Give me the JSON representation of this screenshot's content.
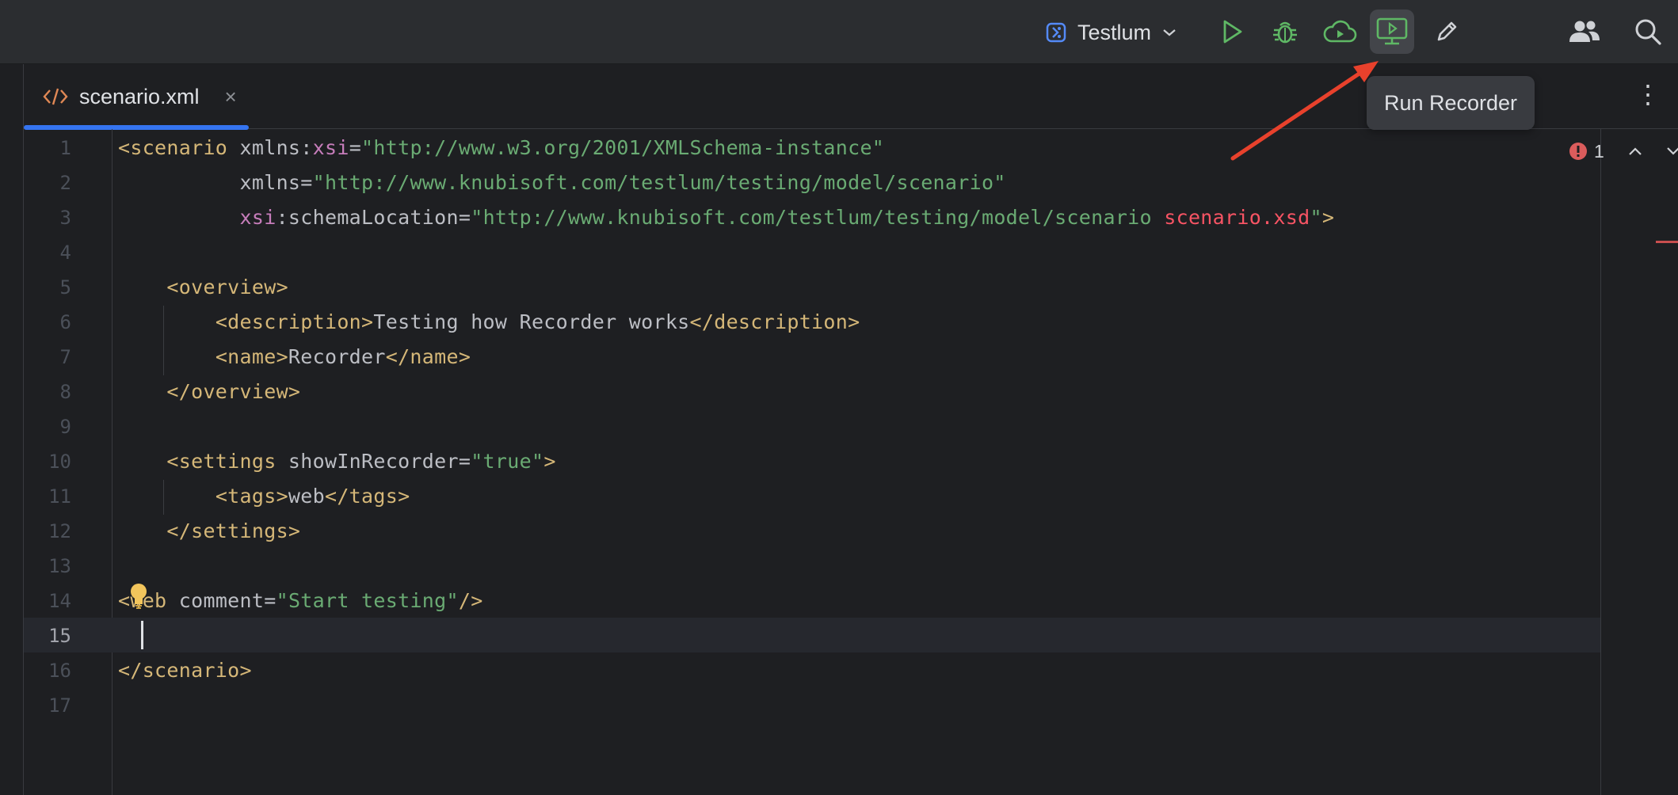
{
  "toolbar": {
    "run_config_label": "Testlum",
    "buttons": [
      {
        "name": "run-button",
        "icon": "play-icon"
      },
      {
        "name": "debug-button",
        "icon": "bug-icon"
      },
      {
        "name": "cloud-run-button",
        "icon": "cloud-play-icon"
      },
      {
        "name": "run-recorder-button",
        "icon": "monitor-play-icon",
        "active": true
      },
      {
        "name": "edit-button",
        "icon": "pencil-icon"
      },
      {
        "name": "collaboration-button",
        "icon": "people-icon"
      },
      {
        "name": "search-button",
        "icon": "search-icon"
      }
    ]
  },
  "tooltip": {
    "text": "Run Recorder"
  },
  "tab": {
    "file_name": "scenario.xml",
    "close_label": "×"
  },
  "inspection": {
    "error_count": "1"
  },
  "editor": {
    "current_line": 15,
    "lines": [
      "1",
      "2",
      "3",
      "4",
      "5",
      "6",
      "7",
      "8",
      "9",
      "10",
      "11",
      "12",
      "13",
      "14",
      "15",
      "16",
      "17"
    ],
    "code": {
      "l1": [
        [
          "t",
          "<scenario "
        ],
        [
          "a",
          "xmlns:"
        ],
        [
          "ns",
          "xsi"
        ],
        [
          "p",
          "="
        ],
        [
          "v",
          "\"http://www.w3.org/2001/XMLSchema-instance\""
        ]
      ],
      "l2": [
        [
          "p",
          "          "
        ],
        [
          "a",
          "xmlns"
        ],
        [
          "p",
          "="
        ],
        [
          "v",
          "\"http://www.knubisoft.com/testlum/testing/model/scenario\""
        ]
      ],
      "l3": [
        [
          "p",
          "          "
        ],
        [
          "ns",
          "xsi"
        ],
        [
          "a",
          ":schemaLocation"
        ],
        [
          "p",
          "="
        ],
        [
          "v",
          "\"http://www.knubisoft.com/testlum/testing/model/scenario "
        ],
        [
          "r",
          "scenario.xsd"
        ],
        [
          "v",
          "\""
        ],
        [
          "t",
          ">"
        ]
      ],
      "l5": [
        [
          "p",
          "    "
        ],
        [
          "t",
          "<overview>"
        ]
      ],
      "l6": [
        [
          "p",
          "        "
        ],
        [
          "t",
          "<description>"
        ],
        [
          "a",
          "Testing how Recorder works"
        ],
        [
          "t",
          "</description>"
        ]
      ],
      "l7": [
        [
          "p",
          "        "
        ],
        [
          "t",
          "<name>"
        ],
        [
          "a",
          "Recorder"
        ],
        [
          "t",
          "</name>"
        ]
      ],
      "l8": [
        [
          "p",
          "    "
        ],
        [
          "t",
          "</overview>"
        ]
      ],
      "l10": [
        [
          "p",
          "    "
        ],
        [
          "t",
          "<settings "
        ],
        [
          "a",
          "showInRecorder"
        ],
        [
          "p",
          "="
        ],
        [
          "v",
          "\"true\""
        ],
        [
          "t",
          ">"
        ]
      ],
      "l11": [
        [
          "p",
          "        "
        ],
        [
          "t",
          "<tags>"
        ],
        [
          "a",
          "web"
        ],
        [
          "t",
          "</tags>"
        ]
      ],
      "l12": [
        [
          "p",
          "    "
        ],
        [
          "t",
          "</settings>"
        ]
      ],
      "l14": [
        [
          "t",
          "<web "
        ],
        [
          "a",
          "comment"
        ],
        [
          "p",
          "="
        ],
        [
          "v",
          "\"Start testing\""
        ],
        [
          "t",
          "/>"
        ]
      ],
      "l16": [
        [
          "t",
          "</scenario>"
        ]
      ]
    }
  },
  "colors": {
    "accent": "#3574f0",
    "run_green": "#5fb865",
    "arrow_red": "#e8412c",
    "tag": "#d5b778",
    "string": "#6aab73",
    "error": "#f75464"
  }
}
